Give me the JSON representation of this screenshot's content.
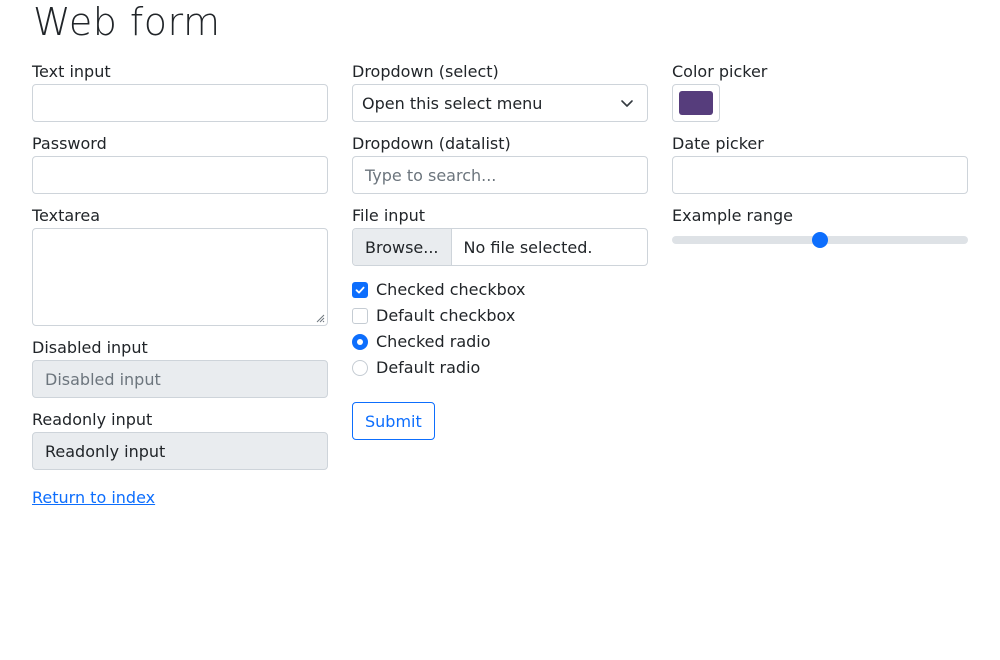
{
  "page": {
    "title": "Web form"
  },
  "column1": {
    "text_input": {
      "label": "Text input",
      "value": ""
    },
    "password": {
      "label": "Password",
      "value": ""
    },
    "textarea": {
      "label": "Textarea",
      "value": ""
    },
    "disabled_input": {
      "label": "Disabled input",
      "placeholder": "Disabled input"
    },
    "readonly_input": {
      "label": "Readonly input",
      "value": "Readonly input"
    }
  },
  "column2": {
    "select": {
      "label": "Dropdown (select)",
      "selected": "Open this select menu",
      "icon": "chevron-down-icon"
    },
    "datalist": {
      "label": "Dropdown (datalist)",
      "placeholder": "Type to search..."
    },
    "file": {
      "label": "File input",
      "button": "Browse...",
      "status": "No file selected."
    },
    "checkboxes": [
      {
        "label": "Checked checkbox",
        "checked": true
      },
      {
        "label": "Default checkbox",
        "checked": false
      }
    ],
    "radios": [
      {
        "label": "Checked radio",
        "checked": true
      },
      {
        "label": "Default radio",
        "checked": false
      }
    ],
    "submit": {
      "label": "Submit"
    }
  },
  "column3": {
    "color_picker": {
      "label": "Color picker",
      "value": "#563d7c"
    },
    "date_picker": {
      "label": "Date picker",
      "value": ""
    },
    "range": {
      "label": "Example range",
      "value": 5,
      "min": 0,
      "max": 10
    }
  },
  "footer": {
    "link": "Return to index"
  },
  "colors": {
    "accent": "#0d6efd",
    "border": "#ced4da",
    "disabled_bg": "#e9ecef"
  }
}
